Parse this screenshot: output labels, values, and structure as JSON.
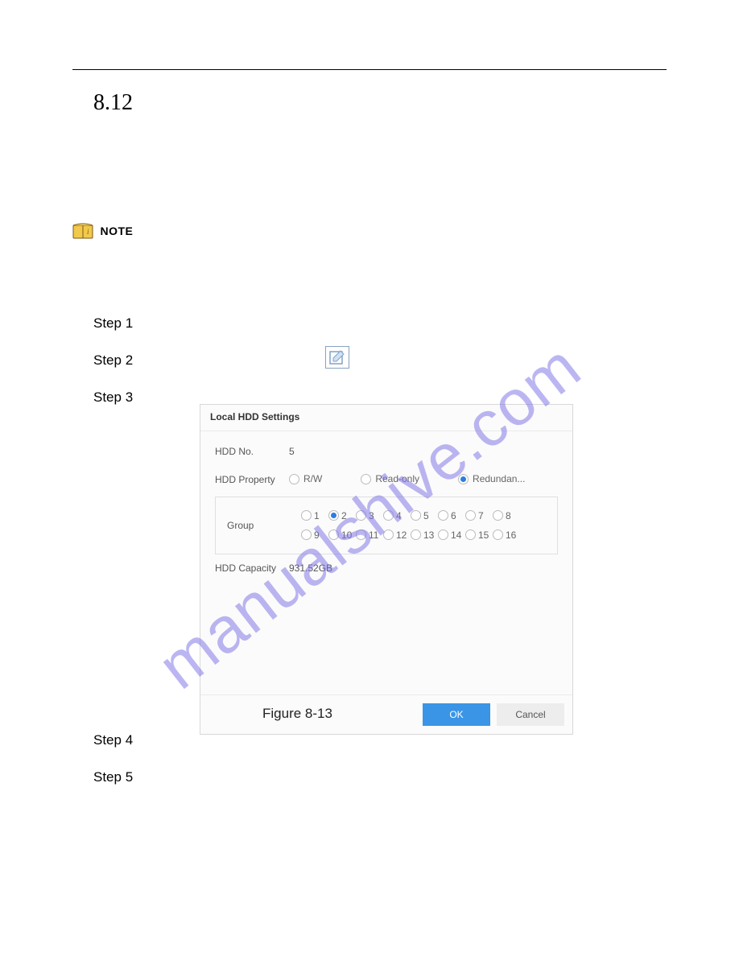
{
  "section_number": "8.12",
  "note": {
    "label": "NOTE"
  },
  "steps_upper": [
    {
      "label": "Step 1"
    },
    {
      "label": "Step 2"
    },
    {
      "label": "Step 3"
    }
  ],
  "steps_lower": [
    {
      "label": "Step 4"
    },
    {
      "label": "Step 5"
    }
  ],
  "dialog": {
    "title": "Local HDD Settings",
    "hdd_no_label": "HDD No.",
    "hdd_no_value": "5",
    "hdd_property_label": "HDD Property",
    "property_options": [
      {
        "label": "R/W",
        "checked": false
      },
      {
        "label": "Read-only",
        "checked": false
      },
      {
        "label": "Redundan...",
        "checked": true
      }
    ],
    "group_label": "Group",
    "group_selected": 2,
    "group_options": [
      1,
      2,
      3,
      4,
      5,
      6,
      7,
      8,
      9,
      10,
      11,
      12,
      13,
      14,
      15,
      16
    ],
    "hdd_capacity_label": "HDD Capacity",
    "hdd_capacity_value": "931.52GB",
    "ok_label": "OK",
    "cancel_label": "Cancel"
  },
  "figure_caption": "Figure 8-13",
  "watermark": "manualshive.com"
}
